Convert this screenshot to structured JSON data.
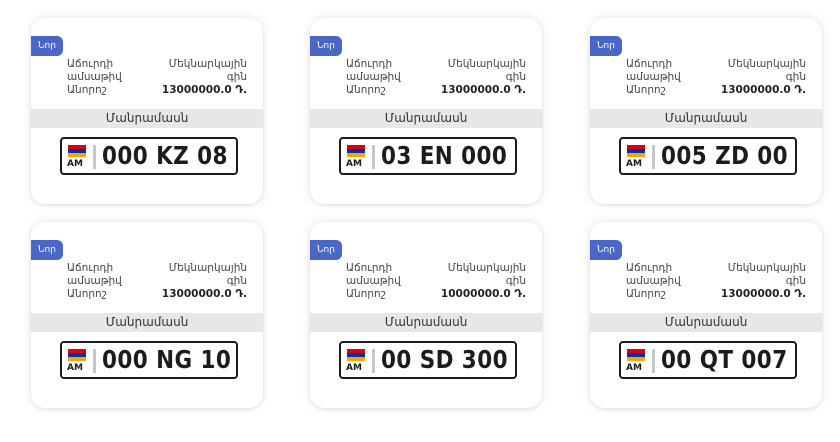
{
  "listings": [
    {
      "badge": "Նոր",
      "col1": [
        "Աճուրդի",
        "ամսաթիվ",
        "Անորոշ"
      ],
      "col2": [
        "Մեկնարկային",
        "գին",
        "13000000.0 Դ."
      ],
      "type": "Մանրամասն",
      "plate": {
        "country": "AM",
        "number": "000 KZ 08"
      }
    },
    {
      "badge": "Նոր",
      "col1": [
        "Աճուրդի",
        "ամսաթիվ",
        "Անորոշ"
      ],
      "col2": [
        "Մեկնարկային",
        "գին",
        "13000000.0 Դ."
      ],
      "type": "Մանրամասն",
      "plate": {
        "country": "AM",
        "number": "03 EN 000"
      }
    },
    {
      "badge": "Նոր",
      "col1": [
        "Աճուրդի",
        "ամսաթիվ",
        "Անորոշ"
      ],
      "col2": [
        "Մեկնարկային",
        "գին",
        "13000000.0 Դ."
      ],
      "type": "Մանրամասն",
      "plate": {
        "country": "AM",
        "number": "005 ZD 00"
      }
    },
    {
      "badge": "Նոր",
      "col1": [
        "Աճուրդի",
        "ամսաթիվ",
        "Անորոշ"
      ],
      "col2": [
        "Մեկնարկային",
        "գին",
        "13000000.0 Դ."
      ],
      "type": "Մանրամասն",
      "plate": {
        "country": "AM",
        "number": "000 NG 10"
      }
    },
    {
      "badge": "Նոր",
      "col1": [
        "Աճուրդի",
        "ամսաթիվ",
        "Անորոշ"
      ],
      "col2": [
        "Մեկնարկային",
        "գին",
        "10000000.0 Դ."
      ],
      "type": "Մանրամասն",
      "plate": {
        "country": "AM",
        "number": "00 SD 300"
      }
    },
    {
      "badge": "Նոր",
      "col1": [
        "Աճուրդի",
        "ամսաթիվ",
        "Անորոշ"
      ],
      "col2": [
        "Մեկնարկային",
        "գին",
        "13000000.0 Դ."
      ],
      "type": "Մանրամասն",
      "plate": {
        "country": "AM",
        "number": "00 QT 007"
      }
    }
  ],
  "colors": {
    "badge": "#4a66c7",
    "type_bar": "#e7e7e7",
    "flag_red": "#d90012",
    "flag_blue": "#0033a0",
    "flag_orange": "#f2a800"
  },
  "icons": {
    "flag": "armenia-flag-icon"
  }
}
